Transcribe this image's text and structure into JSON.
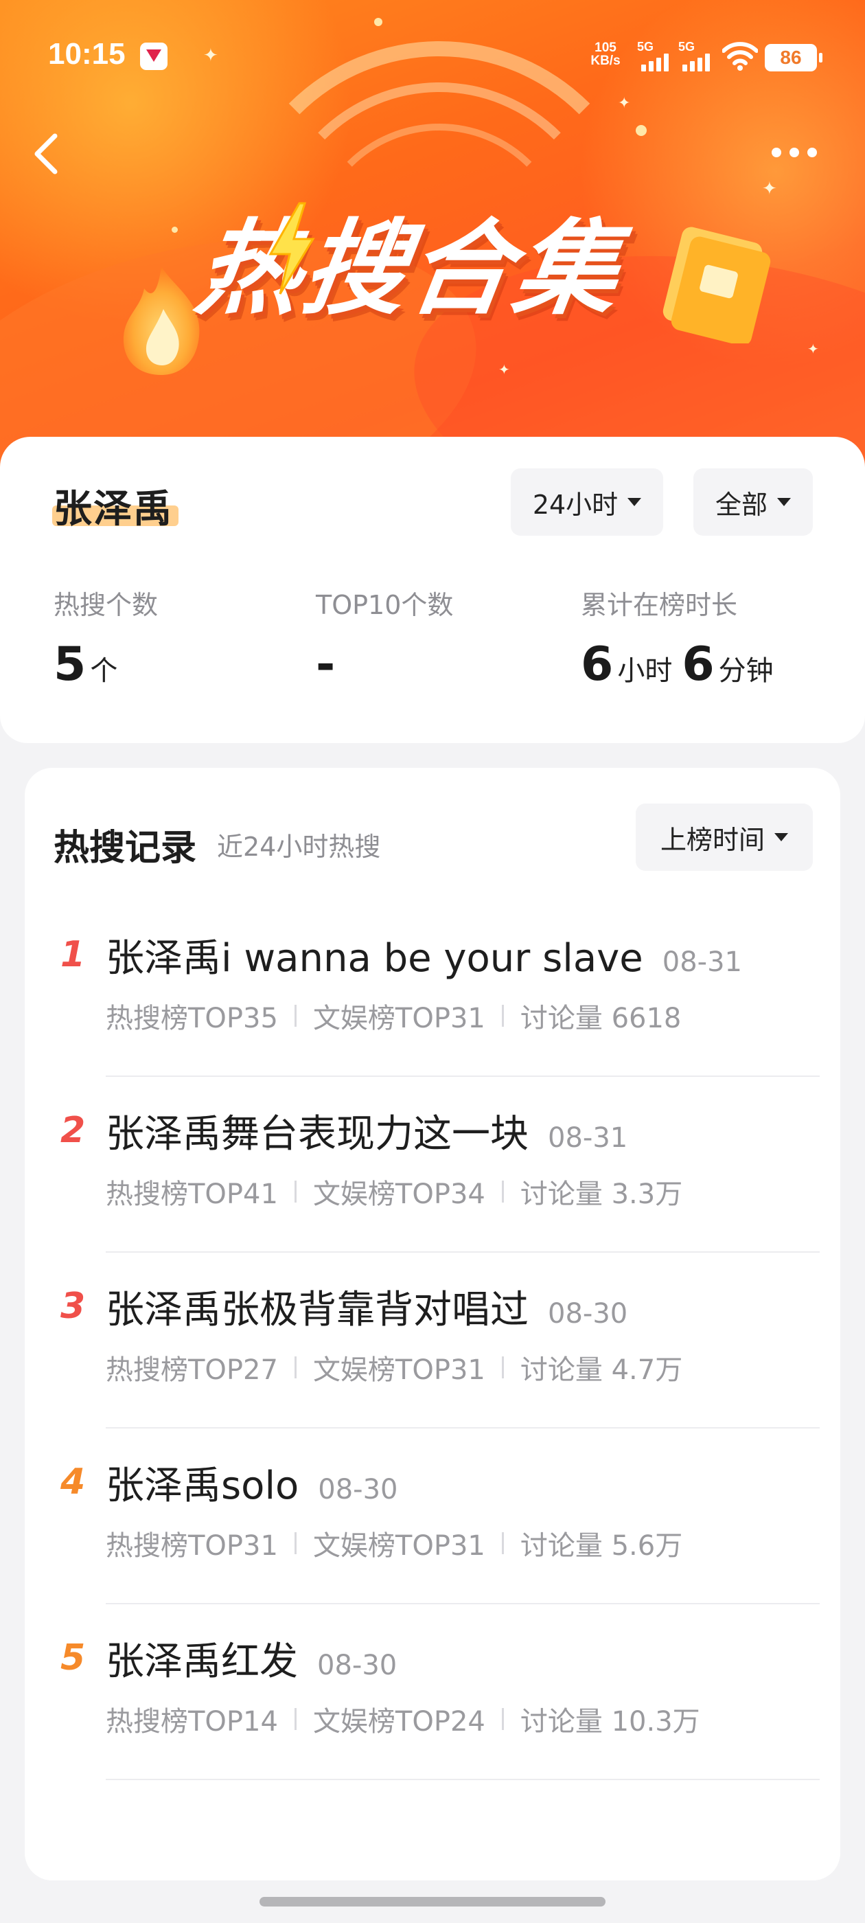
{
  "status_bar": {
    "time": "10:15",
    "net_speed_value": "105",
    "net_speed_unit": "KB/s",
    "signal1_label": "5G",
    "signal2_label": "5G",
    "battery": "86"
  },
  "hero": {
    "title": "热搜合集"
  },
  "summary": {
    "name": "张泽禹",
    "period_filter": "24小时",
    "scope_filter": "全部",
    "stats": [
      {
        "label": "热搜个数",
        "value": "5",
        "unit": "个"
      },
      {
        "label": "TOP10个数",
        "value": "-",
        "unit": ""
      },
      {
        "label": "累计在榜时长",
        "value_hours": "6",
        "unit_hours": "小时",
        "value_minutes": "6",
        "unit_minutes": "分钟"
      }
    ]
  },
  "records": {
    "title": "热搜记录",
    "subtitle": "近24小时热搜",
    "sort_label": "上榜时间",
    "items": [
      {
        "rank": "1",
        "title": "张泽禹i wanna be your slave",
        "date": "08-31",
        "hot_rank": "热搜榜TOP35",
        "ent_rank": "文娱榜TOP31",
        "discussion": "讨论量 6618"
      },
      {
        "rank": "2",
        "title": "张泽禹舞台表现力这一块",
        "date": "08-31",
        "hot_rank": "热搜榜TOP41",
        "ent_rank": "文娱榜TOP34",
        "discussion": "讨论量 3.3万"
      },
      {
        "rank": "3",
        "title": "张泽禹张极背靠背对唱过",
        "date": "08-30",
        "hot_rank": "热搜榜TOP27",
        "ent_rank": "文娱榜TOP31",
        "discussion": "讨论量 4.7万"
      },
      {
        "rank": "4",
        "title": "张泽禹solo",
        "date": "08-30",
        "hot_rank": "热搜榜TOP31",
        "ent_rank": "文娱榜TOP31",
        "discussion": "讨论量 5.6万"
      },
      {
        "rank": "5",
        "title": "张泽禹红发",
        "date": "08-30",
        "hot_rank": "热搜榜TOP14",
        "ent_rank": "文娱榜TOP24",
        "discussion": "讨论量 10.3万"
      }
    ]
  },
  "colors": {
    "accent_red": "#f0504a",
    "accent_orange": "#f68a2a",
    "hero_orange": "#ff6a1a",
    "name_highlight": "#ffcf8e"
  },
  "icons": {
    "back": "chevron-left-icon",
    "more": "more-dots-icon",
    "dropdown": "caret-down-icon"
  }
}
